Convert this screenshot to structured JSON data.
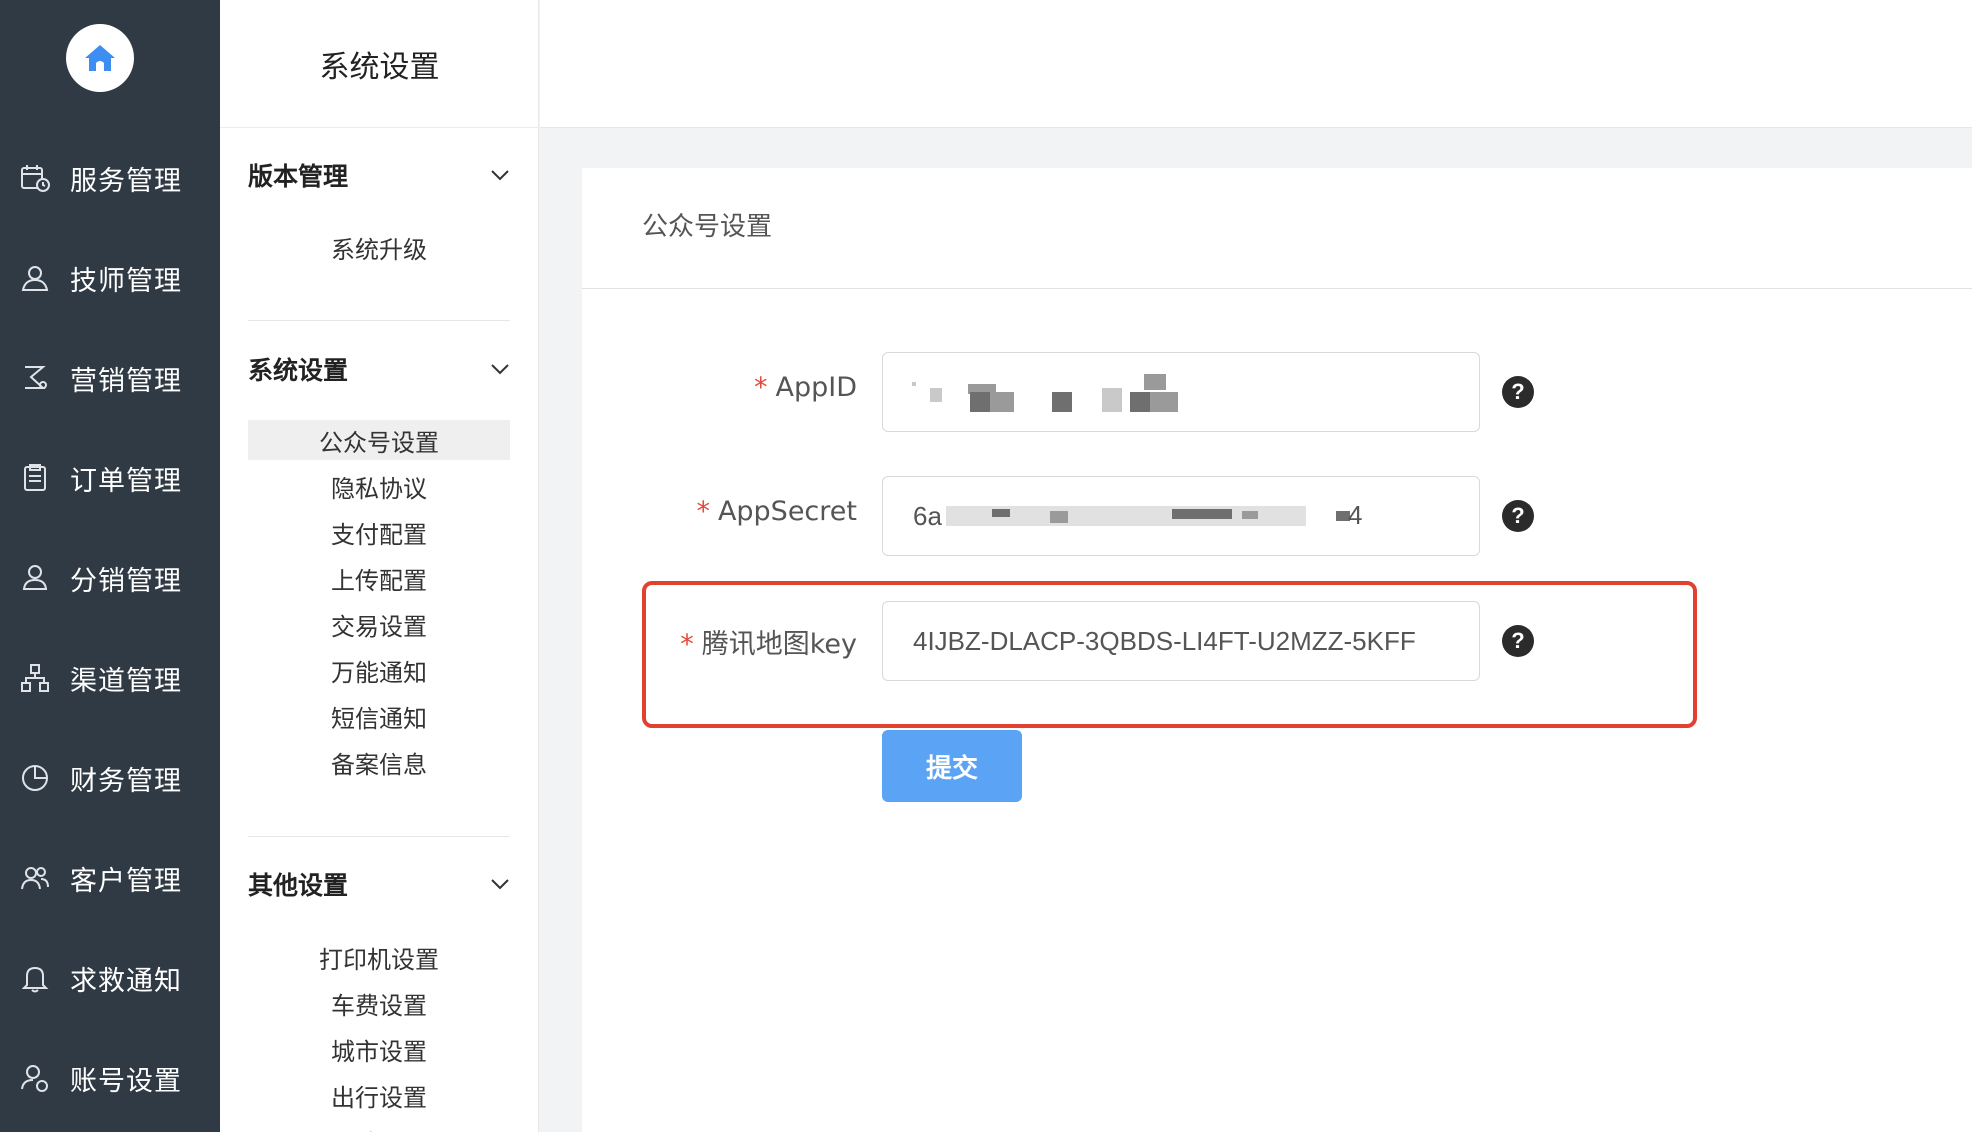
{
  "nav": {
    "items": [
      {
        "label": "服务管理",
        "icon": "calendar-clock-icon"
      },
      {
        "label": "技师管理",
        "icon": "user-icon"
      },
      {
        "label": "营销管理",
        "icon": "marketing-icon"
      },
      {
        "label": "订单管理",
        "icon": "clipboard-icon"
      },
      {
        "label": "分销管理",
        "icon": "user-share-icon"
      },
      {
        "label": "渠道管理",
        "icon": "sitemap-icon"
      },
      {
        "label": "财务管理",
        "icon": "pie-chart-icon"
      },
      {
        "label": "客户管理",
        "icon": "users-icon"
      },
      {
        "label": "求救通知",
        "icon": "bell-icon"
      },
      {
        "label": "账号设置",
        "icon": "account-settings-icon"
      }
    ]
  },
  "submenu": {
    "title": "系统设置",
    "groups": [
      {
        "label": "版本管理",
        "items": [
          "系统升级"
        ]
      },
      {
        "label": "系统设置",
        "items": [
          "公众号设置",
          "隐私协议",
          "支付配置",
          "上传配置",
          "交易设置",
          "万能通知",
          "短信通知",
          "备案信息"
        ]
      },
      {
        "label": "其他设置",
        "items": [
          "打印机设置",
          "车费设置",
          "城市设置",
          "出行设置",
          "其他设置"
        ]
      }
    ],
    "active_item": "公众号设置"
  },
  "card": {
    "title": "公众号设置",
    "fields": [
      {
        "label": "AppID",
        "value": "",
        "required": "*"
      },
      {
        "label": "AppSecret",
        "value": "6a",
        "value_tail": "4",
        "required": "*"
      },
      {
        "label": "腾讯地图key",
        "value": "4IJBZ-DLACP-3QBDS-LI4FT-U2MZZ-5KFF",
        "required": "*"
      }
    ],
    "help_glyph": "?",
    "submit_label": "提交"
  },
  "colors": {
    "sidebar_bg": "#2f3a45",
    "primary_button": "#5aa3f5",
    "required_star": "#e5493a",
    "highlight_border": "#e2412f"
  }
}
